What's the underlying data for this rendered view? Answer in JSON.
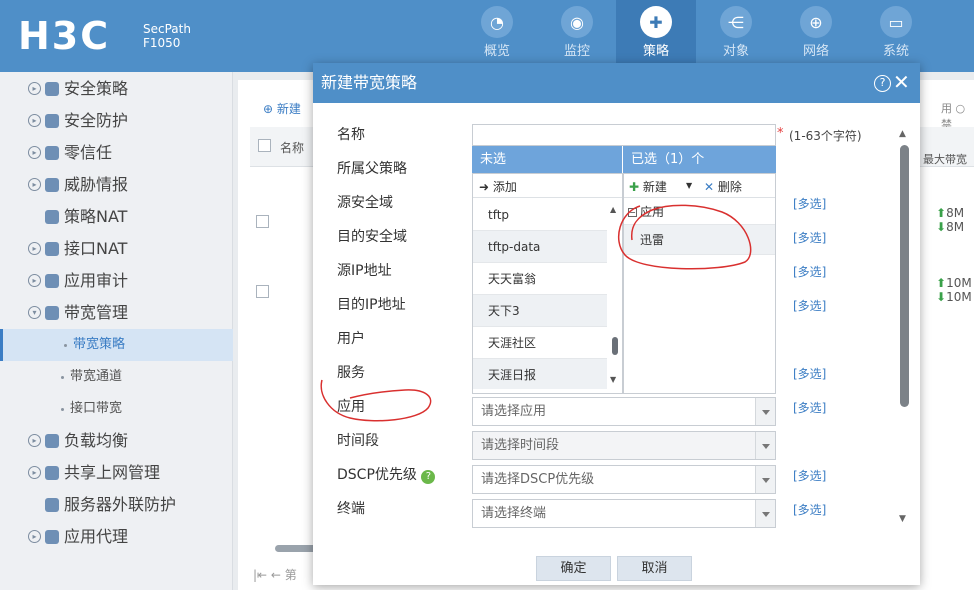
{
  "header": {
    "logo": "H3C",
    "product_line1": "SecPath",
    "product_line2": "F1050",
    "nav": [
      {
        "label": "概览",
        "icon": "gauge-icon"
      },
      {
        "label": "监控",
        "icon": "eye-icon"
      },
      {
        "label": "策略",
        "icon": "shield-icon"
      },
      {
        "label": "对象",
        "icon": "share-icon"
      },
      {
        "label": "网络",
        "icon": "globe-icon"
      },
      {
        "label": "系统",
        "icon": "monitor-icon"
      }
    ],
    "active_nav": "策略"
  },
  "sidebar": {
    "items": [
      {
        "label": "安全策略"
      },
      {
        "label": "安全防护"
      },
      {
        "label": "零信任"
      },
      {
        "label": "威胁情报"
      },
      {
        "label": "策略NAT"
      },
      {
        "label": "接口NAT"
      },
      {
        "label": "应用审计"
      },
      {
        "label": "带宽管理"
      },
      {
        "label": "带宽策略"
      },
      {
        "label": "带宽通道"
      },
      {
        "label": "接口带宽"
      },
      {
        "label": "负载均衡"
      },
      {
        "label": "共享上网管理"
      },
      {
        "label": "服务器外联防护"
      },
      {
        "label": "应用代理"
      }
    ],
    "active": "带宽策略"
  },
  "main": {
    "add_label": "新建",
    "col_name": "名称",
    "col_max": "最大带宽",
    "top_right": "用",
    "top_right2": "禁",
    "rows": [
      {
        "up": "8M",
        "down": "8M"
      },
      {
        "up": "10M",
        "down": "10M"
      }
    ],
    "pager_text": "第"
  },
  "dialog": {
    "title": "新建带宽策略",
    "fields": {
      "name": "名称",
      "parent": "所属父策略",
      "src_zone": "源安全域",
      "dst_zone": "目的安全域",
      "src_ip": "源IP地址",
      "dst_ip": "目的IP地址",
      "user": "用户",
      "service": "服务",
      "app": "应用",
      "time": "时间段",
      "dscp": "DSCP优先级",
      "terminal": "终端"
    },
    "name_value": "",
    "name_hint": "(1-63个字符)",
    "name_required": "*",
    "multi_label": "[多选]",
    "unselected_header": "未选",
    "selected_header": "已选（1）个",
    "add_button": "添加",
    "new_button": "新建",
    "delete_button": "删除",
    "unselected_items": [
      "tftp",
      "tftp-data",
      "天天富翁",
      "天下3",
      "天涯社区",
      "天涯日报"
    ],
    "tree_node": "应用",
    "selected_items": [
      "迅雷"
    ],
    "app_placeholder": "请选择应用",
    "time_placeholder": "请选择时间段",
    "dscp_placeholder": "请选择DSCP优先级",
    "terminal_placeholder": "请选择终端",
    "ok_button": "确定",
    "cancel_button": "取消"
  },
  "colors": {
    "header_bg": "#4f8fc8",
    "dialog_title_bg": "#4f8fc8",
    "list_header_bg": "#6ea4db",
    "link": "#3b7dc4",
    "annotation": "#d9302f"
  }
}
